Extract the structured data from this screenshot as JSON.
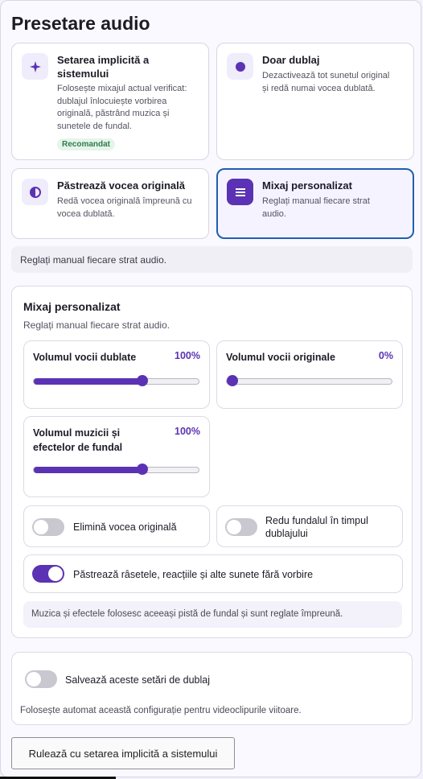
{
  "title": "Presetare audio",
  "presets": [
    {
      "title_line1": "Setarea implicită a",
      "title_line2": "sistemului",
      "desc": [
        "Folosește mixajul actual verificat:",
        "dublajul înlocuiește vorbirea",
        "originală, păstrând muzica și",
        "sunetele de fundal."
      ],
      "badge": "Recomandat",
      "icon": "sparkle-icon",
      "selected": false
    },
    {
      "title": "Doar dublaj",
      "desc": [
        "Dezactivează tot sunetul original",
        "și redă numai vocea dublată."
      ],
      "icon": "dot-icon",
      "selected": false
    },
    {
      "title": "Păstrează vocea originală",
      "desc": [
        "Redă vocea originală împreună cu",
        "vocea dublată."
      ],
      "icon": "half-circle-icon",
      "selected": false
    },
    {
      "title": "Mixaj personalizat",
      "desc": [
        "Reglați manual fiecare strat",
        "audio."
      ],
      "icon": "list-icon",
      "selected": true
    }
  ],
  "info_text": "Reglați manual fiecare strat audio.",
  "mix": {
    "title": "Mixaj personalizat",
    "subtitle": "Reglați manual fiecare strat audio.",
    "sliders": [
      {
        "label": "Volumul vocii dublate",
        "value_label": "100%",
        "value": 0.66
      },
      {
        "label": "Volumul vocii originale",
        "value_label": "0%",
        "value": 0.0
      },
      {
        "label_line1": "Volumul muzicii și",
        "label_line2": "efectelor de fundal",
        "value_label": "100%",
        "value": 0.66
      }
    ],
    "toggles": [
      {
        "label": "Elimină vocea originală",
        "on": false
      },
      {
        "label_line1": "Redu fundalul în timpul",
        "label_line2": "dublajului",
        "on": false
      },
      {
        "label": "Păstrează râsetele, reacțiile și alte sunete fără vorbire",
        "on": true
      }
    ],
    "note": "Muzica și efectele folosesc aceeași pistă de fundal și sunt reglate împreună."
  },
  "save": {
    "label": "Salvează aceste setări de dublaj",
    "on": false,
    "desc": "Folosește automat această configurație pentru videoclipurile viitoare."
  },
  "run_button": "Rulează cu setarea implicită a sistemului",
  "colors": {
    "accent": "#5b32b4",
    "selected_border": "#1f5fb0",
    "badge_green": "#2f7d4a"
  }
}
